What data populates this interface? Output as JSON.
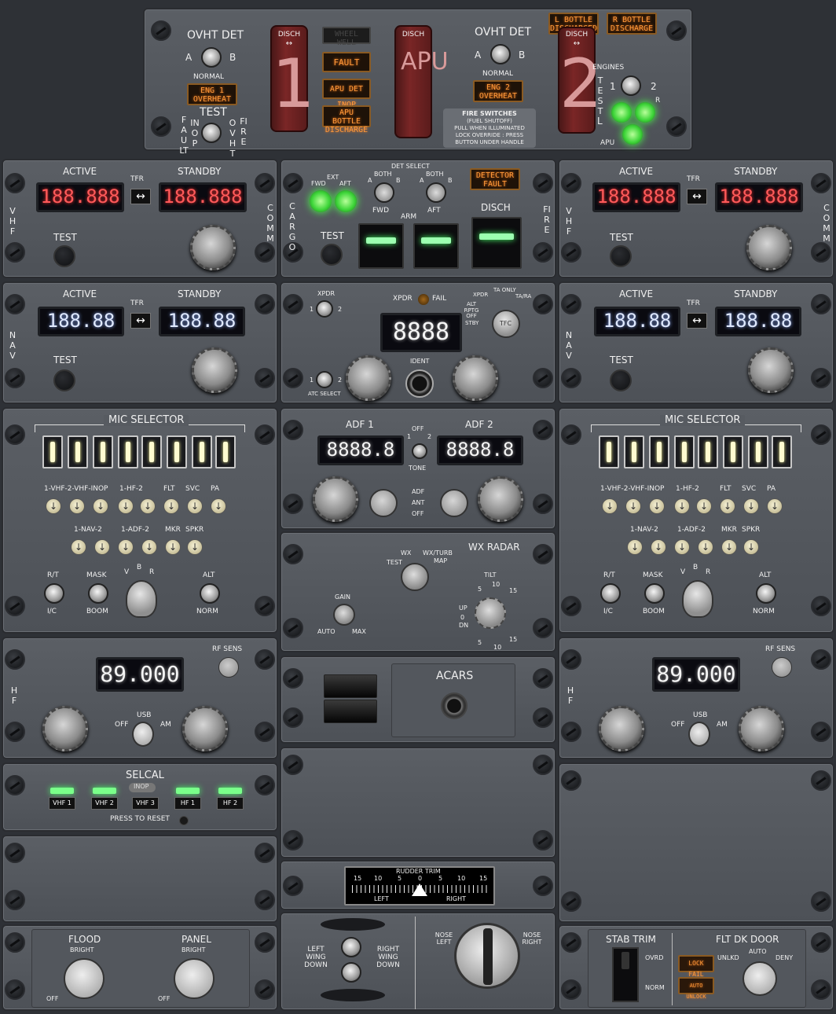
{
  "fire": {
    "ovht_det_left": "OVHT DET",
    "ovht_det_right": "OVHT DET",
    "a": "A",
    "b": "B",
    "normal": "NORMAL",
    "test": "TEST",
    "fault_inop_v": "FAULT",
    "inop_v": "INOP",
    "ovht_v": "OVHT",
    "fire_v": "FIRE",
    "disch": "DISCH",
    "handle1": "1",
    "handle_apu": "APU",
    "handle2": "2",
    "wheel_well": "WHEEL WELL",
    "fault": "FAULT",
    "apu_det_inop": "APU DET INOP",
    "apu_bottle_discharge": "APU BOTTLE DISCHARGE",
    "eng1_overheat": "ENG 1 OVERHEAT",
    "eng2_overheat": "ENG 2 OVERHEAT",
    "l_bottle_discharged": "L BOTTLE DISCHARGED",
    "r_bottle_discharge": "R BOTTLE DISCHARGE",
    "fire_switches_title": "FIRE SWITCHES",
    "fire_switches_note1": "(FUEL SHUTOFF)",
    "fire_switches_note2": "PULL WHEN ILLUMINATED",
    "fire_switches_note3": "LOCK OVERRIDE : PRESS",
    "fire_switches_note4": "BUTTON UNDER HANDLE",
    "engines": "ENGINES",
    "test_v": "TEST",
    "one": "1",
    "two": "2",
    "l": "L",
    "r": "R",
    "apu": "APU"
  },
  "vhf_comm": {
    "active": "ACTIVE",
    "standby": "STANDBY",
    "tfr": "TFR",
    "active_value": "188.888",
    "standby_value": "188.888",
    "test": "TEST",
    "vhf": "VHF",
    "comm": "COMM"
  },
  "nav": {
    "active": "ACTIVE",
    "standby": "STANDBY",
    "tfr": "TFR",
    "active_value": "188.88",
    "standby_value": "188.88",
    "test": "TEST",
    "nav": "NAV"
  },
  "cargo": {
    "cargo": "CARGO",
    "fire": "FIRE",
    "ext": "EXT",
    "fwd": "FWD",
    "aft": "AFT",
    "det_select": "DET SELECT",
    "both": "BOTH",
    "a": "A",
    "b": "B",
    "detector_fault": "DETECTOR FAULT",
    "test": "TEST",
    "arm_fwd": "FWD",
    "arm": "ARM",
    "arm_aft": "AFT",
    "disch": "DISCH"
  },
  "xpdr": {
    "xpdr": "XPDR",
    "xpdr_fail": "XPDR",
    "fail": "FAIL",
    "one": "1",
    "two": "2",
    "code": "8888",
    "ident": "IDENT",
    "atc_select": "ATC SELECT",
    "mode_xpdr": "XPDR",
    "mode_ta_only": "TA ONLY",
    "mode_tara": "TA/RA",
    "mode_alt_rptg_off": "ALT RPTG OFF",
    "mode_stby": "STBY",
    "mode_tfc": "TFC"
  },
  "audio": {
    "mic_selector": "MIC SELECTOR",
    "row1_label": "1-VHF-2-VHF-INOP",
    "hf_label": "1-HF-2",
    "flt": "FLT",
    "svc": "SVC",
    "pa": "PA",
    "nav_label": "1-NAV-2",
    "adf_label": "1-ADF-2",
    "mkr": "MKR",
    "spkr": "SPKR",
    "rt": "R/T",
    "ic": "I/C",
    "mask": "MASK",
    "boom": "BOOM",
    "v": "V",
    "b": "B",
    "r": "R",
    "alt": "ALT",
    "norm": "NORM"
  },
  "adf": {
    "adf1": "ADF 1",
    "adf2": "ADF 2",
    "adf1_value": "8888.8",
    "adf2_value": "8888.8",
    "off": "OFF",
    "one": "1",
    "two": "2",
    "tone": "TONE",
    "mode_adf": "ADF",
    "mode_ant": "ANT",
    "mode_off": "OFF"
  },
  "wx": {
    "title": "WX RADAR",
    "wx": "WX",
    "wx_turb": "WX/TURB",
    "map": "MAP",
    "test": "TEST",
    "gain": "GAIN",
    "auto": "AUTO",
    "max": "MAX",
    "tilt": "TILT",
    "up": "UP",
    "zero": "0",
    "dn": "DN",
    "s5": "5",
    "s10": "10",
    "s15": "15"
  },
  "hf": {
    "value": "89.000",
    "rf_sens": "RF SENS",
    "usb": "USB",
    "off": "OFF",
    "am": "AM",
    "hf": "HF"
  },
  "acars": {
    "title": "ACARS"
  },
  "selcal": {
    "title": "SELCAL",
    "inop": "INOP",
    "reset": "PRESS TO RESET",
    "buttons": [
      "VHF 1",
      "VHF 2",
      "VHF 3",
      "HF 1",
      "HF 2"
    ]
  },
  "rudder": {
    "title": "RUDDER TRIM",
    "left": "LEFT",
    "right": "RIGHT",
    "value": 0,
    "scale": [
      "15",
      "10",
      "5",
      "0",
      "5",
      "10",
      "15"
    ]
  },
  "aileron": {
    "left_wing_down": "LEFT WING DOWN",
    "right_wing_down": "RIGHT WING DOWN",
    "nose_left": "NOSE LEFT",
    "nose_right": "NOSE RIGHT"
  },
  "lighting": {
    "flood": "FLOOD",
    "panel": "PANEL",
    "bright": "BRIGHT",
    "off": "OFF"
  },
  "stab": {
    "title": "STAB TRIM",
    "ovrd": "OVRD",
    "norm": "NORM"
  },
  "door": {
    "title": "FLT DK DOOR",
    "auto": "AUTO",
    "unlkd": "UNLKD",
    "deny": "DENY",
    "lock_fail": "LOCK FAIL",
    "auto_unlock": "AUTO UNLOCK"
  },
  "colors": {
    "panel": "#55595f",
    "amber": "#ff9a3a",
    "green": "#4aff4a",
    "lcd_red": "#ff5a5a",
    "lcd_blue": "#dfe9ff"
  }
}
